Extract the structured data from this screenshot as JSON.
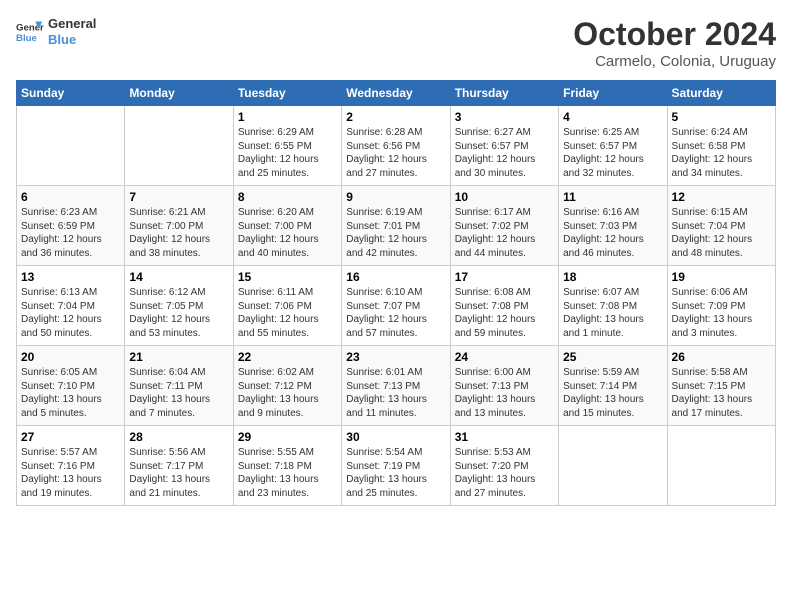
{
  "header": {
    "logo_line1": "General",
    "logo_line2": "Blue",
    "month": "October 2024",
    "location": "Carmelo, Colonia, Uruguay"
  },
  "days_of_week": [
    "Sunday",
    "Monday",
    "Tuesday",
    "Wednesday",
    "Thursday",
    "Friday",
    "Saturday"
  ],
  "weeks": [
    [
      {
        "day": "",
        "content": ""
      },
      {
        "day": "",
        "content": ""
      },
      {
        "day": "1",
        "content": "Sunrise: 6:29 AM\nSunset: 6:55 PM\nDaylight: 12 hours\nand 25 minutes."
      },
      {
        "day": "2",
        "content": "Sunrise: 6:28 AM\nSunset: 6:56 PM\nDaylight: 12 hours\nand 27 minutes."
      },
      {
        "day": "3",
        "content": "Sunrise: 6:27 AM\nSunset: 6:57 PM\nDaylight: 12 hours\nand 30 minutes."
      },
      {
        "day": "4",
        "content": "Sunrise: 6:25 AM\nSunset: 6:57 PM\nDaylight: 12 hours\nand 32 minutes."
      },
      {
        "day": "5",
        "content": "Sunrise: 6:24 AM\nSunset: 6:58 PM\nDaylight: 12 hours\nand 34 minutes."
      }
    ],
    [
      {
        "day": "6",
        "content": "Sunrise: 6:23 AM\nSunset: 6:59 PM\nDaylight: 12 hours\nand 36 minutes."
      },
      {
        "day": "7",
        "content": "Sunrise: 6:21 AM\nSunset: 7:00 PM\nDaylight: 12 hours\nand 38 minutes."
      },
      {
        "day": "8",
        "content": "Sunrise: 6:20 AM\nSunset: 7:00 PM\nDaylight: 12 hours\nand 40 minutes."
      },
      {
        "day": "9",
        "content": "Sunrise: 6:19 AM\nSunset: 7:01 PM\nDaylight: 12 hours\nand 42 minutes."
      },
      {
        "day": "10",
        "content": "Sunrise: 6:17 AM\nSunset: 7:02 PM\nDaylight: 12 hours\nand 44 minutes."
      },
      {
        "day": "11",
        "content": "Sunrise: 6:16 AM\nSunset: 7:03 PM\nDaylight: 12 hours\nand 46 minutes."
      },
      {
        "day": "12",
        "content": "Sunrise: 6:15 AM\nSunset: 7:04 PM\nDaylight: 12 hours\nand 48 minutes."
      }
    ],
    [
      {
        "day": "13",
        "content": "Sunrise: 6:13 AM\nSunset: 7:04 PM\nDaylight: 12 hours\nand 50 minutes."
      },
      {
        "day": "14",
        "content": "Sunrise: 6:12 AM\nSunset: 7:05 PM\nDaylight: 12 hours\nand 53 minutes."
      },
      {
        "day": "15",
        "content": "Sunrise: 6:11 AM\nSunset: 7:06 PM\nDaylight: 12 hours\nand 55 minutes."
      },
      {
        "day": "16",
        "content": "Sunrise: 6:10 AM\nSunset: 7:07 PM\nDaylight: 12 hours\nand 57 minutes."
      },
      {
        "day": "17",
        "content": "Sunrise: 6:08 AM\nSunset: 7:08 PM\nDaylight: 12 hours\nand 59 minutes."
      },
      {
        "day": "18",
        "content": "Sunrise: 6:07 AM\nSunset: 7:08 PM\nDaylight: 13 hours\nand 1 minute."
      },
      {
        "day": "19",
        "content": "Sunrise: 6:06 AM\nSunset: 7:09 PM\nDaylight: 13 hours\nand 3 minutes."
      }
    ],
    [
      {
        "day": "20",
        "content": "Sunrise: 6:05 AM\nSunset: 7:10 PM\nDaylight: 13 hours\nand 5 minutes."
      },
      {
        "day": "21",
        "content": "Sunrise: 6:04 AM\nSunset: 7:11 PM\nDaylight: 13 hours\nand 7 minutes."
      },
      {
        "day": "22",
        "content": "Sunrise: 6:02 AM\nSunset: 7:12 PM\nDaylight: 13 hours\nand 9 minutes."
      },
      {
        "day": "23",
        "content": "Sunrise: 6:01 AM\nSunset: 7:13 PM\nDaylight: 13 hours\nand 11 minutes."
      },
      {
        "day": "24",
        "content": "Sunrise: 6:00 AM\nSunset: 7:13 PM\nDaylight: 13 hours\nand 13 minutes."
      },
      {
        "day": "25",
        "content": "Sunrise: 5:59 AM\nSunset: 7:14 PM\nDaylight: 13 hours\nand 15 minutes."
      },
      {
        "day": "26",
        "content": "Sunrise: 5:58 AM\nSunset: 7:15 PM\nDaylight: 13 hours\nand 17 minutes."
      }
    ],
    [
      {
        "day": "27",
        "content": "Sunrise: 5:57 AM\nSunset: 7:16 PM\nDaylight: 13 hours\nand 19 minutes."
      },
      {
        "day": "28",
        "content": "Sunrise: 5:56 AM\nSunset: 7:17 PM\nDaylight: 13 hours\nand 21 minutes."
      },
      {
        "day": "29",
        "content": "Sunrise: 5:55 AM\nSunset: 7:18 PM\nDaylight: 13 hours\nand 23 minutes."
      },
      {
        "day": "30",
        "content": "Sunrise: 5:54 AM\nSunset: 7:19 PM\nDaylight: 13 hours\nand 25 minutes."
      },
      {
        "day": "31",
        "content": "Sunrise: 5:53 AM\nSunset: 7:20 PM\nDaylight: 13 hours\nand 27 minutes."
      },
      {
        "day": "",
        "content": ""
      },
      {
        "day": "",
        "content": ""
      }
    ]
  ]
}
